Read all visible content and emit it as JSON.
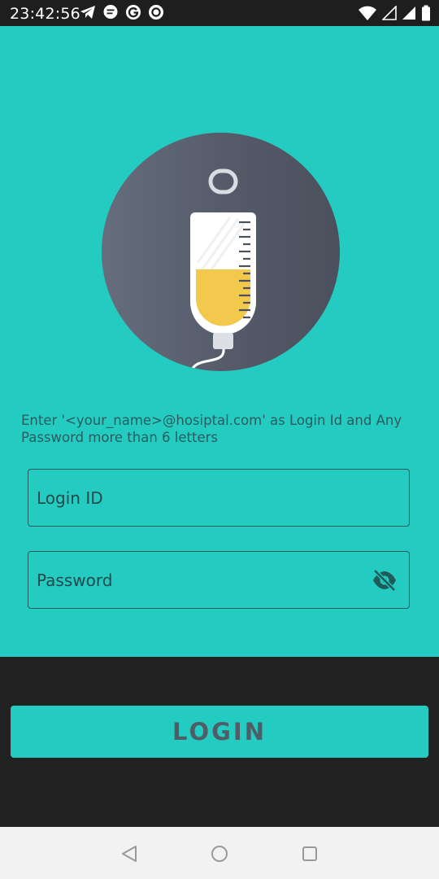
{
  "status_bar": {
    "time": "23:42:56",
    "notification_icons": [
      "telegram-icon",
      "message-icon",
      "google-icon",
      "record-icon"
    ],
    "system_icons": [
      "wifi-icon",
      "signal-empty-icon",
      "signal-full-icon",
      "battery-icon"
    ]
  },
  "hero": {
    "illustration": "iv-drip-bag-icon",
    "fill_level": 0.45,
    "fill_color": "#f2c94c"
  },
  "hint": {
    "text": "Enter '<your_name>@hosiptal.com' as Login Id and Any Password more than 6 letters"
  },
  "login_field": {
    "placeholder": "Login ID",
    "value": ""
  },
  "password_field": {
    "placeholder": "Password",
    "value": "",
    "toggle_icon": "eye-off-icon"
  },
  "login_button": {
    "label": "LOGIN"
  },
  "nav_bar": {
    "items": [
      "back-icon",
      "home-icon",
      "recents-icon"
    ]
  },
  "colors": {
    "accent": "#24cbc0",
    "dark": "#222222",
    "label": "#4f5e66"
  }
}
